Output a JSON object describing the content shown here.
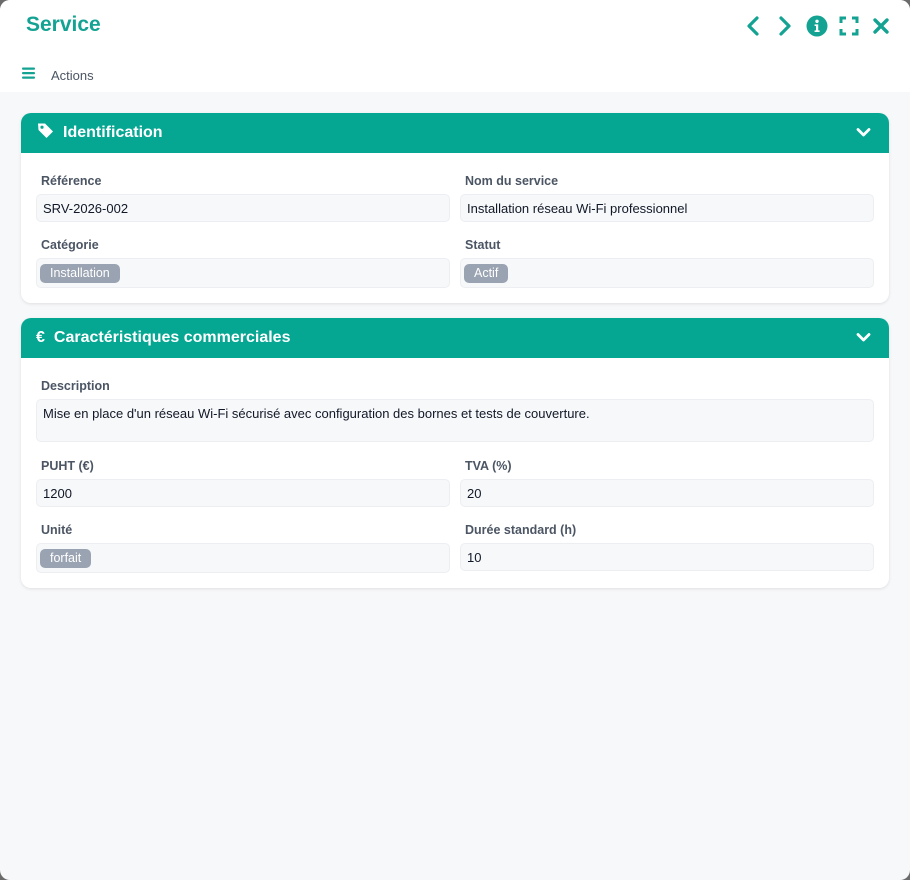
{
  "window": {
    "title": "Service",
    "header_icons": [
      "chevron-left-icon",
      "chevron-right-icon",
      "info-icon",
      "expand-icon",
      "close-icon"
    ],
    "accent_color": "#05a793"
  },
  "toolbar": {
    "actions_label": "Actions"
  },
  "identification": {
    "title": "Identification",
    "reference_label": "Référence",
    "reference_value": "SRV-2026-002",
    "name_label": "Nom du service",
    "name_value": "Installation réseau Wi-Fi professionnel",
    "category_label": "Catégorie",
    "category_value": "Installation",
    "status_label": "Statut",
    "status_value": "Actif"
  },
  "commercial": {
    "title": "Caractéristiques commerciales",
    "description_label": "Description",
    "description_value": "Mise en place d'un réseau Wi-Fi sécurisé avec configuration des bornes et tests de couverture.",
    "puht_label": "PUHT (€)",
    "puht_value": "1200",
    "tva_label": "TVA (%)",
    "tva_value": "20",
    "unit_label": "Unité",
    "unit_value": "forfait",
    "duration_label": "Durée standard (h)",
    "duration_value": "10"
  }
}
